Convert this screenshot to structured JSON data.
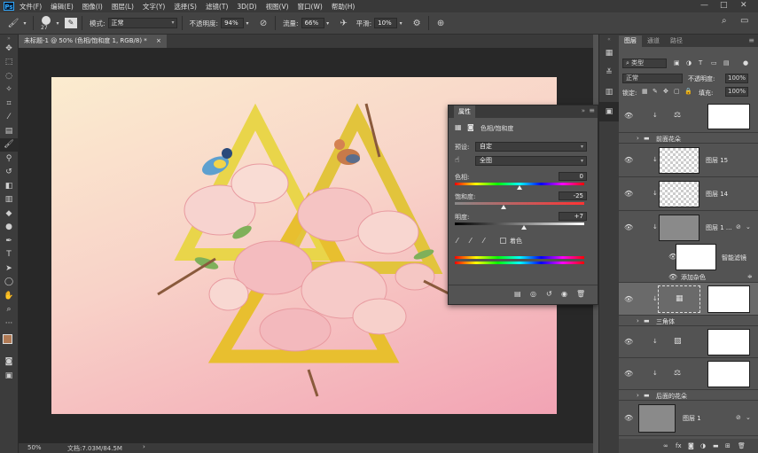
{
  "menubar": {
    "logo": "Ps",
    "items": [
      "文件(F)",
      "编辑(E)",
      "图像(I)",
      "图层(L)",
      "文字(Y)",
      "选择(S)",
      "滤镜(T)",
      "3D(D)",
      "视图(V)",
      "窗口(W)",
      "帮助(H)"
    ],
    "window_controls": [
      "—",
      "□",
      "✕"
    ]
  },
  "options": {
    "brush_size": "27",
    "mode_label": "模式:",
    "mode_value": "正常",
    "opacity_label": "不透明度:",
    "opacity_value": "94%",
    "flow_label": "流量:",
    "flow_value": "66%",
    "smooth_label": "平滑:",
    "smooth_value": "10%"
  },
  "document": {
    "tab_title": "未标题-1 @ 50% (色相/饱和度 1, RGB/8) *",
    "zoom": "50%",
    "doc_info": "文档:7.03M/84.5M"
  },
  "properties": {
    "title": "属性",
    "adjustment_name": "色相/饱和度",
    "preset_label": "预设:",
    "preset_value": "自定",
    "channel_value": "全图",
    "hue_label": "色相:",
    "hue_value": "0",
    "saturation_label": "饱和度:",
    "saturation_value": "-25",
    "lightness_label": "明度:",
    "lightness_value": "+7",
    "colorize_label": "着色",
    "hue_level": 0.5,
    "saturation_level": 0.375,
    "lightness_level": 0.535
  },
  "layers_panel": {
    "tabs": [
      "图层",
      "通道",
      "路径"
    ],
    "filter_value": "类型",
    "blend_mode": "正常",
    "opacity_label": "不透明度:",
    "opacity_value": "100%",
    "lock_label": "锁定:",
    "fill_label": "填充:",
    "fill_value": "100%",
    "layers": [
      {
        "name": "",
        "kind": "adjust-levels"
      },
      {
        "name": "前面花朵",
        "kind": "group"
      },
      {
        "name": "图层 15",
        "kind": "pixel"
      },
      {
        "name": "图层 14",
        "kind": "pixel"
      },
      {
        "name": "图层 1 ...",
        "kind": "smart"
      },
      {
        "name": "智能滤镜",
        "kind": "filter-mask"
      },
      {
        "name": "添加杂色",
        "kind": "filter"
      },
      {
        "name": "",
        "kind": "adjust-hue"
      },
      {
        "name": "三角体",
        "kind": "group"
      },
      {
        "name": "",
        "kind": "adjust-curves"
      },
      {
        "name": "",
        "kind": "adjust-levels2"
      },
      {
        "name": "后面的花朵",
        "kind": "group"
      },
      {
        "name": "图层 1",
        "kind": "smart"
      }
    ]
  }
}
